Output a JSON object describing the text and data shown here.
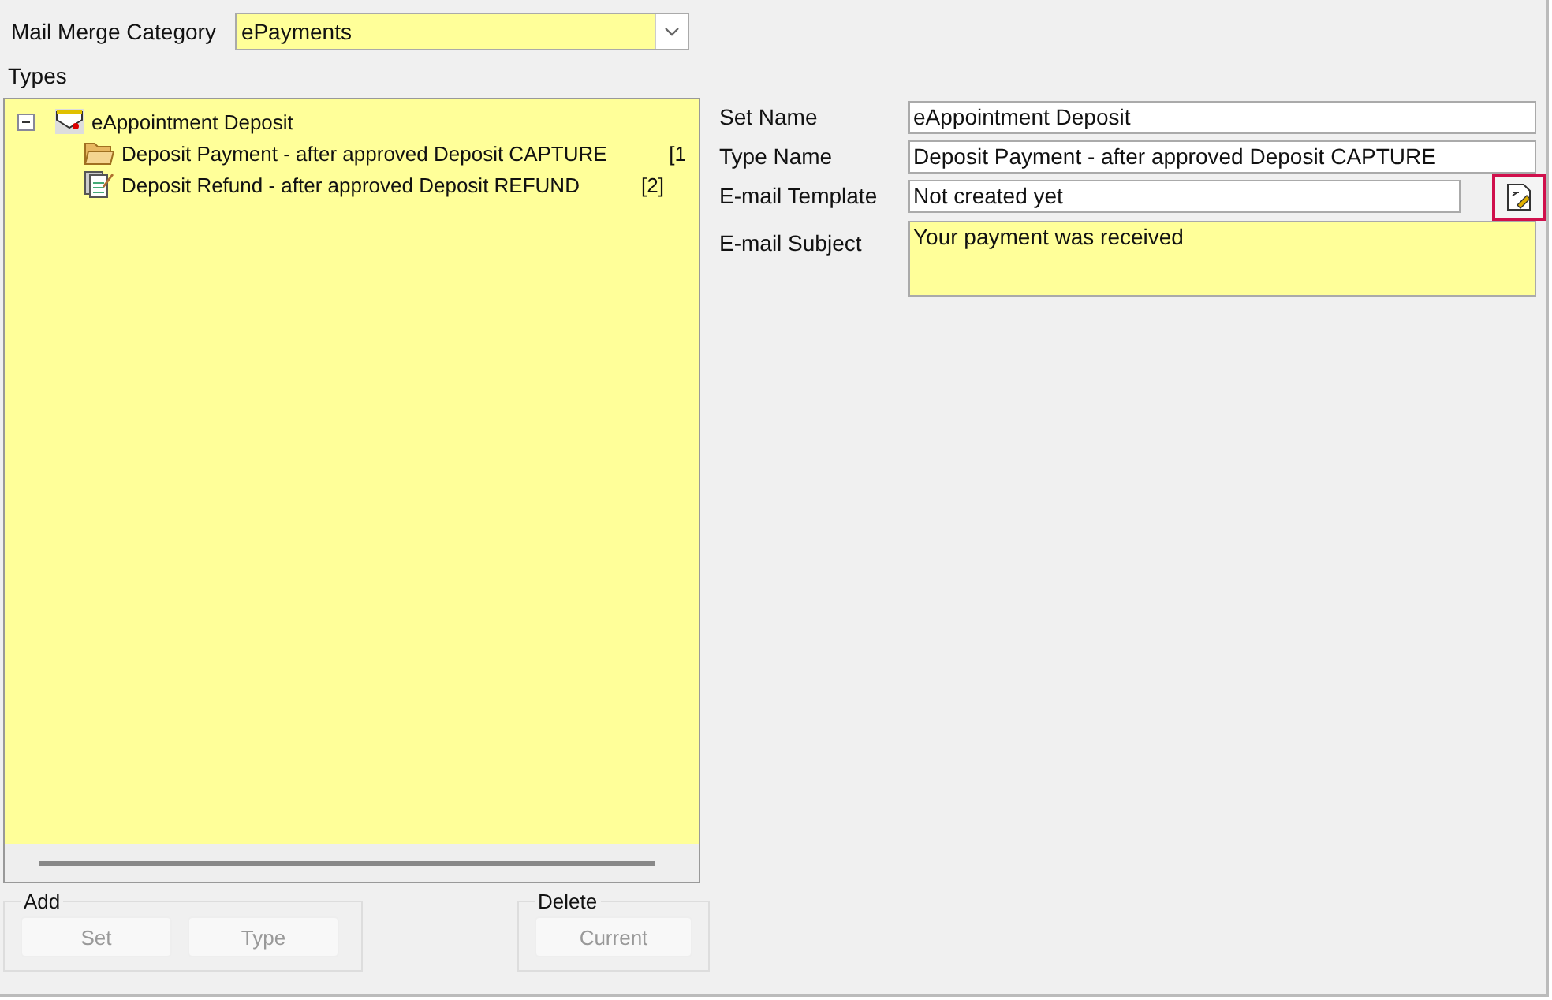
{
  "category": {
    "label": "Mail Merge Category",
    "value": "ePayments"
  },
  "types_label": "Types",
  "tree": [
    {
      "label": "eAppointment Deposit",
      "kind": "set",
      "expanded": true,
      "children": [
        {
          "label": "Deposit Payment - after approved Deposit CAPTURE",
          "kind": "folder",
          "count": "[1"
        },
        {
          "label": "Deposit Refund - after approved Deposit REFUND",
          "kind": "document",
          "count": "[2]"
        }
      ]
    }
  ],
  "form": [
    {
      "label": "Set Name",
      "value": "eAppointment Deposit",
      "kind": "text"
    },
    {
      "label": "Type Name",
      "value": "Deposit Payment - after approved Deposit CAPTURE",
      "kind": "text"
    },
    {
      "label": "E-mail Template",
      "value": "Not created yet",
      "kind": "template"
    },
    {
      "label": "E-mail Subject",
      "value": "Your payment was received",
      "kind": "memo"
    }
  ],
  "groups": [
    {
      "title": "Add",
      "buttons": [
        {
          "label": "Set",
          "disabled": true
        },
        {
          "label": "Type",
          "disabled": true
        }
      ]
    },
    {
      "title": "Delete",
      "buttons": [
        {
          "label": "Current",
          "disabled": true
        }
      ]
    }
  ]
}
